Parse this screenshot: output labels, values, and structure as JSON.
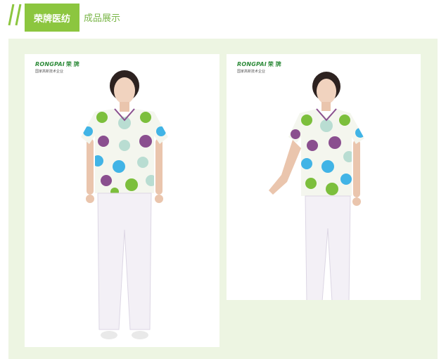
{
  "header": {
    "brand_badge": "荣牌医纺",
    "section_title": "成品展示"
  },
  "products": [
    {
      "logo": {
        "brand": "RONGPAI",
        "brand_cn": "荣 牌",
        "tagline": "国家高新技术企业"
      },
      "pose": "front",
      "image_description_icon": "model-front-icon"
    },
    {
      "logo": {
        "brand": "RONGPAI",
        "brand_cn": "荣 牌",
        "tagline": "国家高新技术企业"
      },
      "pose": "angled",
      "image_description_icon": "model-angled-icon"
    }
  ],
  "colors": {
    "accent_green": "#8cc63f",
    "panel_bg": "#edf5e2",
    "dot_green": "#7cbf3c",
    "dot_purple": "#8a4f8f",
    "dot_blue": "#41b4e6",
    "dot_mint": "#b9ddd2",
    "pants": "#f3f0f6"
  }
}
